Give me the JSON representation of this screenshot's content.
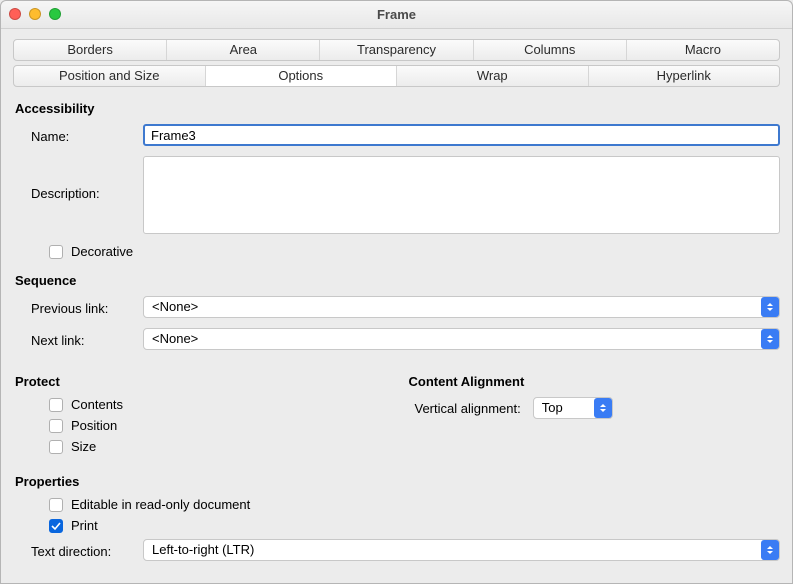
{
  "window": {
    "title": "Frame"
  },
  "tabs_row1": {
    "borders": "Borders",
    "area": "Area",
    "transparency": "Transparency",
    "columns": "Columns",
    "macro": "Macro"
  },
  "tabs_row2": {
    "position_size": "Position and Size",
    "options": "Options",
    "wrap": "Wrap",
    "hyperlink": "Hyperlink"
  },
  "accessibility": {
    "heading": "Accessibility",
    "name_label": "Name:",
    "name_value": "Frame3",
    "description_label": "Description:",
    "description_value": "",
    "decorative_label": "Decorative",
    "decorative_checked": false
  },
  "sequence": {
    "heading": "Sequence",
    "prev_label": "Previous link:",
    "prev_value": "<None>",
    "next_label": "Next link:",
    "next_value": "<None>"
  },
  "protect": {
    "heading": "Protect",
    "contents_label": "Contents",
    "contents_checked": false,
    "position_label": "Position",
    "position_checked": false,
    "size_label": "Size",
    "size_checked": false
  },
  "content_alignment": {
    "heading": "Content Alignment",
    "va_label": "Vertical alignment:",
    "va_value": "Top"
  },
  "properties": {
    "heading": "Properties",
    "editable_label": "Editable in read-only document",
    "editable_checked": false,
    "print_label": "Print",
    "print_checked": true,
    "textdir_label": "Text direction:",
    "textdir_value": "Left-to-right (LTR)"
  }
}
